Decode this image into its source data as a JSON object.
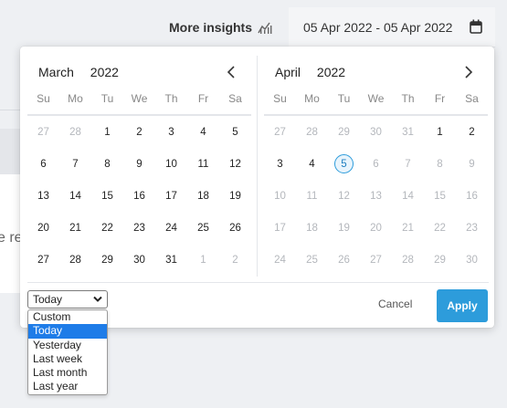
{
  "background": {
    "partial_text": "e re"
  },
  "header": {
    "insights_label": "More insights",
    "date_range": "05 Apr 2022 - 05 Apr 2022"
  },
  "weekdays": [
    "Su",
    "Mo",
    "Tu",
    "We",
    "Th",
    "Fr",
    "Sa"
  ],
  "calendars": [
    {
      "month": "March",
      "year": "2022",
      "weeks": [
        [
          [
            "27",
            1
          ],
          [
            "28",
            1
          ],
          [
            "1",
            0
          ],
          [
            "2",
            0
          ],
          [
            "3",
            0
          ],
          [
            "4",
            0
          ],
          [
            "5",
            0
          ]
        ],
        [
          [
            "6",
            0
          ],
          [
            "7",
            0
          ],
          [
            "8",
            0
          ],
          [
            "9",
            0
          ],
          [
            "10",
            0
          ],
          [
            "11",
            0
          ],
          [
            "12",
            0
          ]
        ],
        [
          [
            "13",
            0
          ],
          [
            "14",
            0
          ],
          [
            "15",
            0
          ],
          [
            "16",
            0
          ],
          [
            "17",
            0
          ],
          [
            "18",
            0
          ],
          [
            "19",
            0
          ]
        ],
        [
          [
            "20",
            0
          ],
          [
            "21",
            0
          ],
          [
            "22",
            0
          ],
          [
            "23",
            0
          ],
          [
            "24",
            0
          ],
          [
            "25",
            0
          ],
          [
            "26",
            0
          ]
        ],
        [
          [
            "27",
            0
          ],
          [
            "28",
            0
          ],
          [
            "29",
            0
          ],
          [
            "30",
            0
          ],
          [
            "31",
            0
          ],
          [
            "1",
            1
          ],
          [
            "2",
            1
          ]
        ]
      ]
    },
    {
      "month": "April",
      "year": "2022",
      "weeks": [
        [
          [
            "27",
            1
          ],
          [
            "28",
            1
          ],
          [
            "29",
            1
          ],
          [
            "30",
            1
          ],
          [
            "31",
            1
          ],
          [
            "1",
            0
          ],
          [
            "2",
            0
          ]
        ],
        [
          [
            "3",
            0
          ],
          [
            "4",
            0
          ],
          [
            "5",
            2
          ],
          [
            "6",
            1
          ],
          [
            "7",
            1
          ],
          [
            "8",
            1
          ],
          [
            "9",
            1
          ]
        ],
        [
          [
            "10",
            1
          ],
          [
            "11",
            1
          ],
          [
            "12",
            1
          ],
          [
            "13",
            1
          ],
          [
            "14",
            1
          ],
          [
            "15",
            1
          ],
          [
            "16",
            1
          ]
        ],
        [
          [
            "17",
            1
          ],
          [
            "18",
            1
          ],
          [
            "19",
            1
          ],
          [
            "20",
            1
          ],
          [
            "21",
            1
          ],
          [
            "22",
            1
          ],
          [
            "23",
            1
          ]
        ],
        [
          [
            "24",
            1
          ],
          [
            "25",
            1
          ],
          [
            "26",
            1
          ],
          [
            "27",
            1
          ],
          [
            "28",
            1
          ],
          [
            "29",
            1
          ],
          [
            "30",
            1
          ]
        ]
      ]
    }
  ],
  "footer": {
    "range_value": "Today",
    "cancel_label": "Cancel",
    "apply_label": "Apply"
  },
  "range_options": [
    "Custom",
    "Today",
    "Yesterday",
    "Last week",
    "Last month",
    "Last year"
  ],
  "highlighted_option": "Today",
  "colors": {
    "accent": "#2d9cdb",
    "highlight": "#1e7ce8",
    "muted": "#b4b7bc"
  }
}
